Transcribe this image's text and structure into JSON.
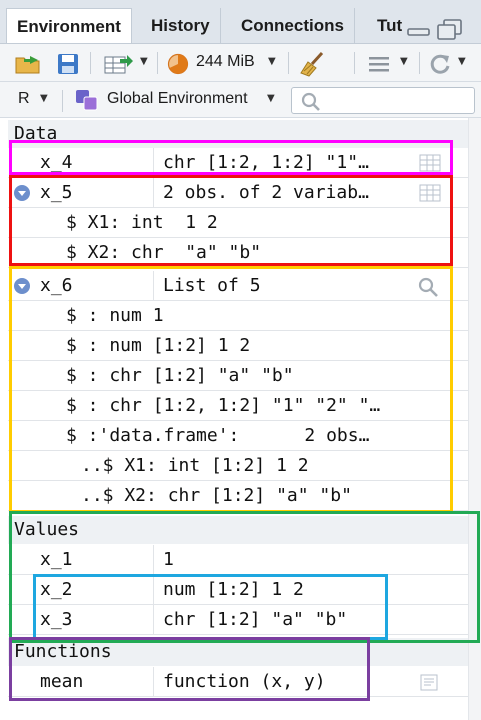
{
  "tabs": [
    {
      "label": "Environment"
    },
    {
      "label": "History"
    },
    {
      "label": "Connections"
    },
    {
      "label": "Tut"
    }
  ],
  "toolbar": {
    "memory": "244 MiB",
    "language": "R",
    "environment": "Global Environment"
  },
  "sections": {
    "data": "Data",
    "values": "Values",
    "functions": "Functions"
  },
  "data_rows": [
    {
      "name": "x_4",
      "value": "chr [1:2, 1:2] \"1\"…"
    },
    {
      "name": "x_5",
      "value": "2 obs. of 2 variab…"
    },
    {
      "sub": "$ X1: int  1 2"
    },
    {
      "sub": "$ X2: chr  \"a\" \"b\""
    },
    {
      "name": "x_6",
      "value": "List of  5"
    },
    {
      "sub": "$ : num 1"
    },
    {
      "sub": "$ : num [1:2] 1 2"
    },
    {
      "sub": "$ : chr [1:2] \"a\" \"b\""
    },
    {
      "sub": "$ : chr [1:2, 1:2] \"1\" \"2\" \"…"
    },
    {
      "sub": "$ :'data.frame':      2 obs…"
    },
    {
      "sub": "..$ X1: int [1:2] 1 2"
    },
    {
      "sub": "..$ X2: chr [1:2] \"a\" \"b\""
    }
  ],
  "value_rows": [
    {
      "name": "x_1",
      "value": "1"
    },
    {
      "name": "x_2",
      "value": "num [1:2] 1 2"
    },
    {
      "name": "x_3",
      "value": "chr [1:2] \"a\" \"b\""
    }
  ],
  "function_rows": [
    {
      "name": "mean",
      "value": "function (x, y)"
    }
  ],
  "icons": [
    "load-workspace-icon",
    "save-workspace-icon",
    "import-dataset-icon",
    "memory-pie-icon",
    "broom-icon",
    "list-view-icon",
    "refresh-icon",
    "search-icon",
    "grid-view-icon",
    "magnifier-icon",
    "code-view-icon",
    "minimize-icon",
    "maximize-icon",
    "environment-icon"
  ],
  "colors": {
    "highlight_x4": "#ff00ff",
    "highlight_x5": "#ee1111",
    "highlight_x6": "#ffcc00",
    "highlight_values": "#22aa55",
    "highlight_x2_x3": "#1ea7e0",
    "highlight_functions": "#7b3fa0",
    "expander": "#6d8fcc"
  }
}
